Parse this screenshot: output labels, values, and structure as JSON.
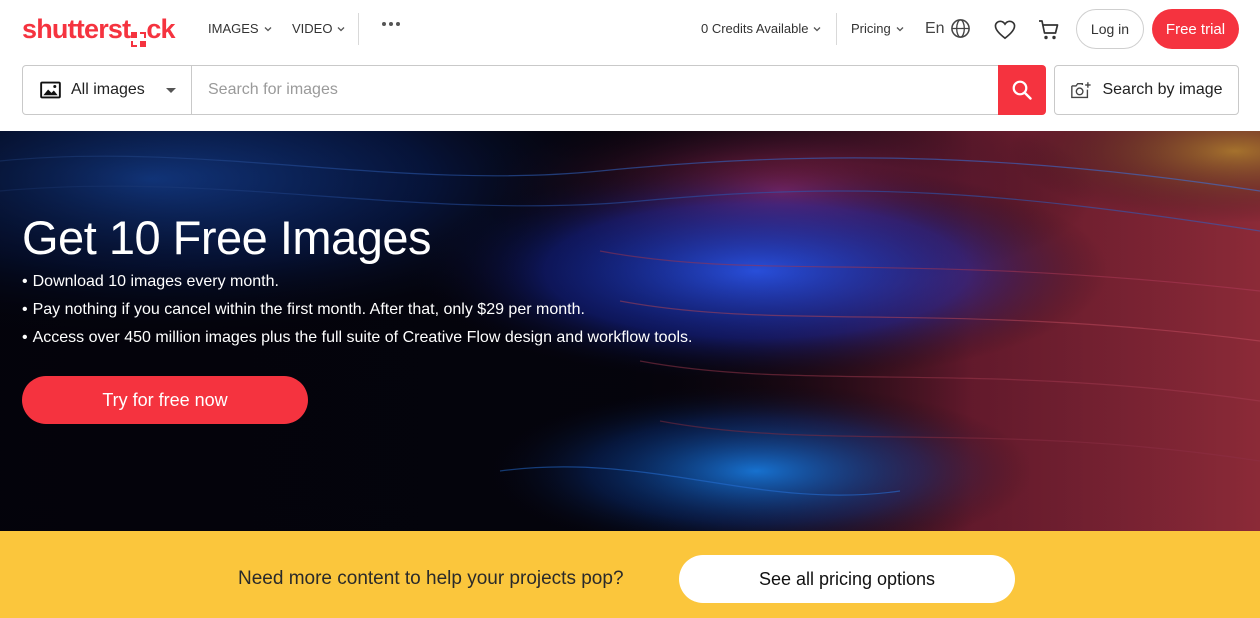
{
  "brand": {
    "logo_text_before": "shutterst",
    "logo_text_after": "ck",
    "accent_color": "#f5333f"
  },
  "nav": {
    "images_label": "IMAGES",
    "video_label": "VIDEO",
    "credits_label": "0 Credits Available",
    "pricing_label": "Pricing",
    "language_label": "En",
    "login_label": "Log in",
    "free_trial_label": "Free trial",
    "icons": [
      "chevron-down-icon",
      "more-dots-icon",
      "globe-icon",
      "heart-icon",
      "cart-icon"
    ]
  },
  "search": {
    "type_selected": "All images",
    "placeholder": "Search for images",
    "search_by_image_label": "Search by image",
    "icons": [
      "image-icon",
      "search-icon",
      "camera-plus-icon"
    ]
  },
  "hero": {
    "title": "Get 10 Free Images",
    "bullets": [
      "Download 10 images every month.",
      "Pay nothing if you cancel within the first month. After that, only $29 per month.",
      "Access over 450 million images plus the full suite of Creative Flow design and workflow tools."
    ],
    "cta_label": "Try for free now"
  },
  "promo": {
    "text": "Need more content to help your projects pop?",
    "button_label": "See all pricing options",
    "background_color": "#fbc63c"
  }
}
